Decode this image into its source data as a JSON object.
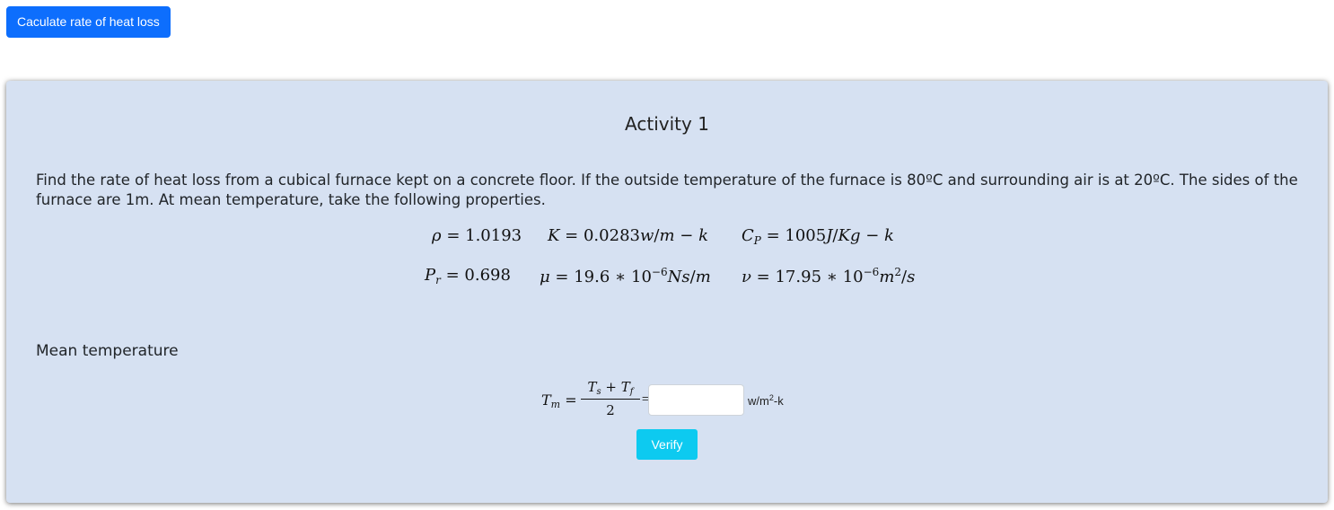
{
  "top_button": {
    "label": "Caculate rate of heat loss"
  },
  "card": {
    "title": "Activity 1",
    "problem": "Find the rate of heat loss from a cubical furnace kept on a concrete floor. If the outside temperature of the furnace is 80ºC and surrounding air is at 20ºC. The sides of the furnace are 1m. At mean temperature, take the following properties.",
    "properties": {
      "rho_value": "1.0193",
      "k_value": "0.0283",
      "cp_value": "1005",
      "pr_value": "0.698",
      "mu_value": "19.6",
      "mu_exp": "−6",
      "nu_value": "17.95",
      "nu_exp": "−6"
    },
    "section_heading": "Mean temperature",
    "formula": {
      "lhs_symbol": "T",
      "lhs_sub": "m",
      "numerator_a": "T",
      "numerator_a_sub": "s",
      "numerator_b": "T",
      "numerator_b_sub": "f",
      "denominator": "2",
      "equals": "="
    },
    "answer_input": {
      "value": "",
      "placeholder": ""
    },
    "unit_label": "w/m",
    "unit_power": "2",
    "unit_suffix": "-k",
    "verify_label": "Verify"
  },
  "colors": {
    "primary_button": "#0d6efd",
    "verify_button": "#0dcaf0",
    "card_background": "#d6e1f2"
  }
}
